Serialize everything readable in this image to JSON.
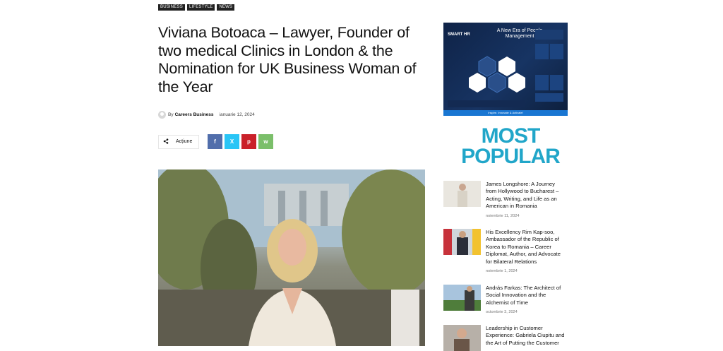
{
  "tags": [
    "BUSINESS",
    "LIFESTYLE",
    "NEWS"
  ],
  "article": {
    "title": "Viviana Botoaca – Lawyer, Founder of two medical Clinics in London & the Nomination for UK Business Woman of the Year",
    "by_label": "By",
    "author": "Careers Business",
    "date": "ianuarie 12, 2024",
    "share_label": "Acțiune",
    "social": {
      "facebook": "f",
      "x": "X",
      "pinterest": "p",
      "whatsapp": "w"
    }
  },
  "sidebar": {
    "ad": {
      "brand": "SMART HR",
      "headline": "A New Era of People Management",
      "footer": "Inspire. Innovate & Activate!"
    },
    "popular_heading": "MOST POPULAR",
    "popular": [
      {
        "title": "James Longshore: A Journey from Hollywood to Bucharest – Acting, Writing, and Life as an American in Romania",
        "date": "noiembrie 11, 2024"
      },
      {
        "title": "His Excellency Rim Kap-soo, Ambassador of the Republic of Korea to Romania – Career Diplomat, Author, and Advocate for Bilateral Relations",
        "date": "noiembrie 1, 2024"
      },
      {
        "title": "András Farkas: The Architect of Social Innovation and the Alchemist of Time",
        "date": "octombrie 3, 2024"
      },
      {
        "title": "Leadership in Customer Experience: Gabriela Ciupitu and the Art of Putting the Customer",
        "date": ""
      }
    ]
  }
}
